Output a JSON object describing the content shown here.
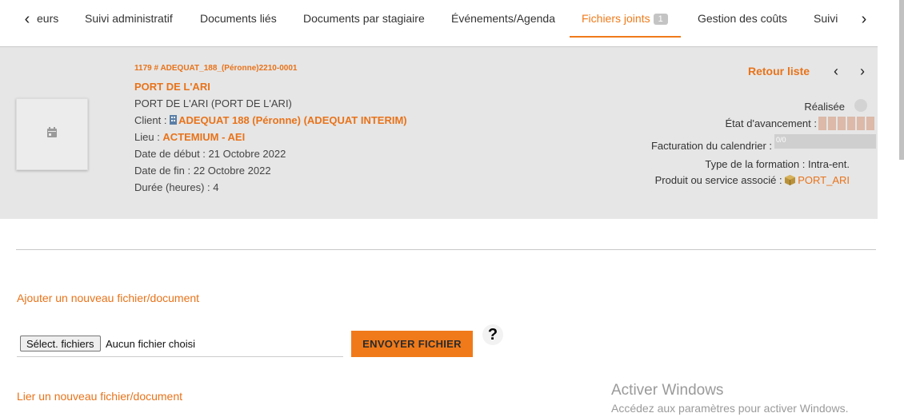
{
  "tabs": {
    "prev_arrow": "‹",
    "next_arrow": "›",
    "items": [
      {
        "label": "eurs"
      },
      {
        "label": "Suivi administratif"
      },
      {
        "label": "Documents liés"
      },
      {
        "label": "Documents par stagiaire"
      },
      {
        "label": "Événements/Agenda"
      },
      {
        "label": "Fichiers joints",
        "badge": "1",
        "active": true
      },
      {
        "label": "Gestion des coûts"
      },
      {
        "label": "Suivi"
      }
    ]
  },
  "record": {
    "ref": "1179 # ADEQUAT_188_(Péronne)2210-0001",
    "title": "PORT DE L'ARI",
    "subtitle": "PORT DE L'ARI (PORT DE L'ARI)",
    "client_label": "Client : ",
    "client_value": "ADEQUAT 188 (Péronne) (ADEQUAT INTERIM)",
    "lieu_label": "Lieu : ",
    "lieu_value": "ACTEMIUM - AEI",
    "start_date": "Date de début : 21 Octobre 2022",
    "end_date": "Date de fin : 22 Octobre 2022",
    "duration": "Durée (heures) : 4"
  },
  "right_panel": {
    "back_label": "Retour liste",
    "realisee_label": "Réalisée",
    "avancement_label": "État d'avancement :",
    "avancement_blocks": 6,
    "facturation_label": "Facturation du calendrier :",
    "facturation_value": "0/0",
    "type_formation": "Type de la formation : Intra-ent.",
    "produit_label": "Produit ou service associé : ",
    "produit_value": "PORT_ARI"
  },
  "upload": {
    "add_link": "Ajouter un nouveau fichier/document",
    "choose_button": "Sélect. fichiers",
    "no_file": "Aucun fichier choisi",
    "send_button": "ENVOYER FICHIER",
    "help": "?",
    "link_link": "Lier un nouveau fichier/document"
  },
  "watermark": {
    "title": "Activer Windows",
    "subtitle": "Accédez aux paramètres pour activer Windows."
  },
  "colors": {
    "accent": "#f07a1a",
    "panel_bg": "#e6e6e6",
    "progress_block": "#dcb9a8"
  }
}
